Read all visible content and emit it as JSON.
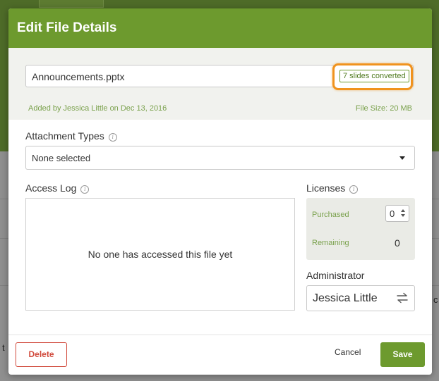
{
  "background": {
    "fragment_left": "t",
    "fragment_right": "c"
  },
  "modal": {
    "title": "Edit File Details",
    "file": {
      "name": "Announcements.pptx",
      "conversion_badge": "7 slides converted",
      "added_by": "Added by Jessica Little on Dec 13, 2016",
      "file_size": "File Size: 20 MB"
    },
    "attachment_types": {
      "label": "Attachment Types",
      "selected": "None selected"
    },
    "access_log": {
      "label": "Access Log",
      "empty_message": "No one has accessed this file yet"
    },
    "licenses": {
      "label": "Licenses",
      "purchased_label": "Purchased",
      "purchased_value": "0",
      "remaining_label": "Remaining",
      "remaining_value": "0"
    },
    "administrator": {
      "label": "Administrator",
      "value": "Jessica Little"
    },
    "footer": {
      "delete_label": "Delete",
      "cancel_label": "Cancel",
      "save_label": "Save"
    }
  },
  "colors": {
    "header_green": "#6d9a2e",
    "highlight_orange": "#f0931e",
    "delete_red": "#d14b3d",
    "meta_green": "#7aa14c"
  }
}
